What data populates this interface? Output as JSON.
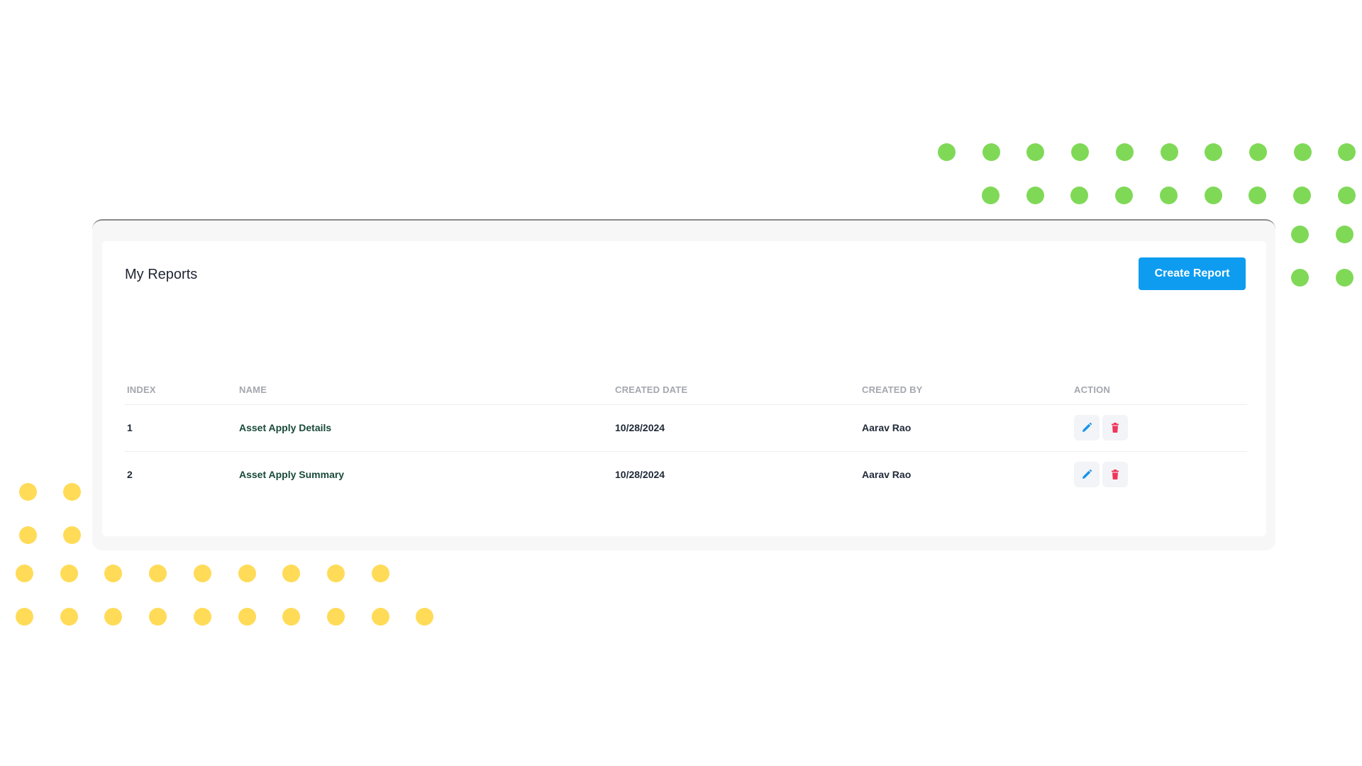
{
  "page": {
    "title": "My Reports"
  },
  "toolbar": {
    "create_label": "Create Report"
  },
  "table": {
    "columns": [
      "INDEX",
      "NAME",
      "CREATED DATE",
      "CREATED BY",
      "ACTION"
    ],
    "rows": [
      {
        "index": "1",
        "name": "Asset Apply Details",
        "created_date": "10/28/2024",
        "created_by": "Aarav Rao"
      },
      {
        "index": "2",
        "name": "Asset Apply Summary",
        "created_date": "10/28/2024",
        "created_by": "Aarav Rao"
      }
    ],
    "actions": {
      "edit_icon": "pencil-icon",
      "delete_icon": "trash-icon"
    }
  },
  "colors": {
    "accent": "#0d9cf0",
    "edit": "#1793e8",
    "delete": "#f0355a",
    "dots_green": "#7fd957",
    "dots_yellow": "#ffdb57"
  }
}
